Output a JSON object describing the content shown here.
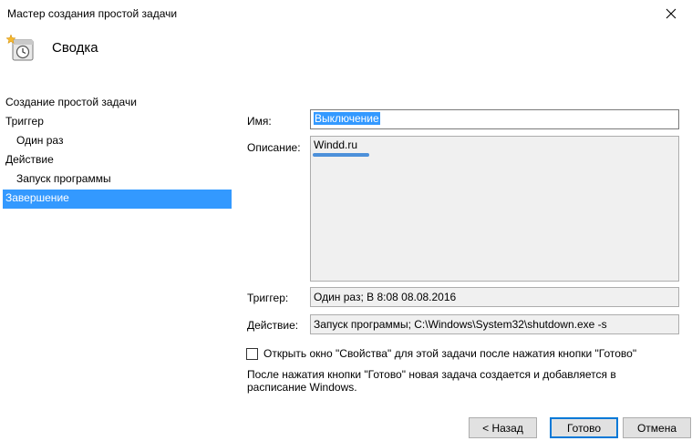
{
  "window": {
    "title": "Мастер создания простой задачи",
    "close_icon": "close-icon"
  },
  "header": {
    "icon": "task-scheduler-icon",
    "heading": "Сводка"
  },
  "steps": [
    {
      "label": "Создание простой задачи"
    },
    {
      "label": "Триггер"
    },
    {
      "label": "Один раз"
    },
    {
      "label": "Действие"
    },
    {
      "label": "Запуск программы"
    },
    {
      "label": "Завершение"
    }
  ],
  "summary": {
    "name_label": "Имя:",
    "name_value": "Выключение",
    "description_label": "Описание:",
    "description_value": "Windd.ru",
    "trigger_label": "Триггер:",
    "trigger_value": "Один раз; В 8:08 08.08.2016",
    "action_label": "Действие:",
    "action_value": "Запуск программы; C:\\Windows\\System32\\shutdown.exe -s"
  },
  "open_properties": {
    "label": "Открыть окно \"Свойства\" для этой задачи после нажатия кнопки \"Готово\"",
    "checked": false
  },
  "note": "После нажатия кнопки \"Готово\" новая задача создается и добавляется в расписание Windows.",
  "buttons": {
    "back": "< Назад",
    "finish": "Готово",
    "cancel": "Отмена"
  },
  "colors": {
    "selection": "#3399ff",
    "accent": "#0078d7"
  }
}
